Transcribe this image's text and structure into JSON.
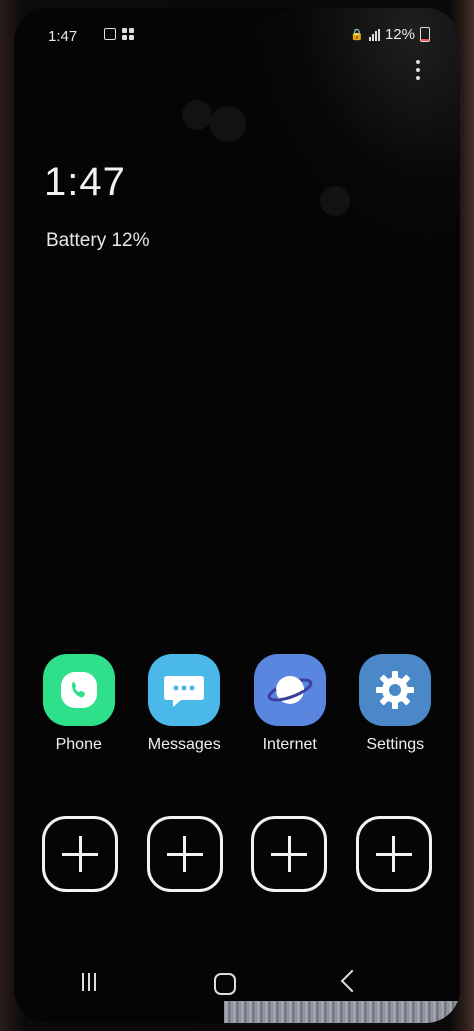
{
  "status_bar": {
    "time": "1:47",
    "battery_percent": "12%",
    "battery_level_fraction": 0.12
  },
  "lock_screen": {
    "clock": "1:47",
    "battery_text": "Battery 12%"
  },
  "apps": [
    {
      "label": "Phone",
      "icon": "phone-icon",
      "color": "#2ee08a"
    },
    {
      "label": "Messages",
      "icon": "messages-icon",
      "color": "#4ab8e8"
    },
    {
      "label": "Internet",
      "icon": "internet-icon",
      "color": "#5a86e0"
    },
    {
      "label": "Settings",
      "icon": "settings-icon",
      "color": "#4a88c8"
    }
  ],
  "add_slots_count": 4,
  "navigation": {
    "recent": "recent-apps-icon",
    "home": "home-icon",
    "back": "back-icon"
  }
}
